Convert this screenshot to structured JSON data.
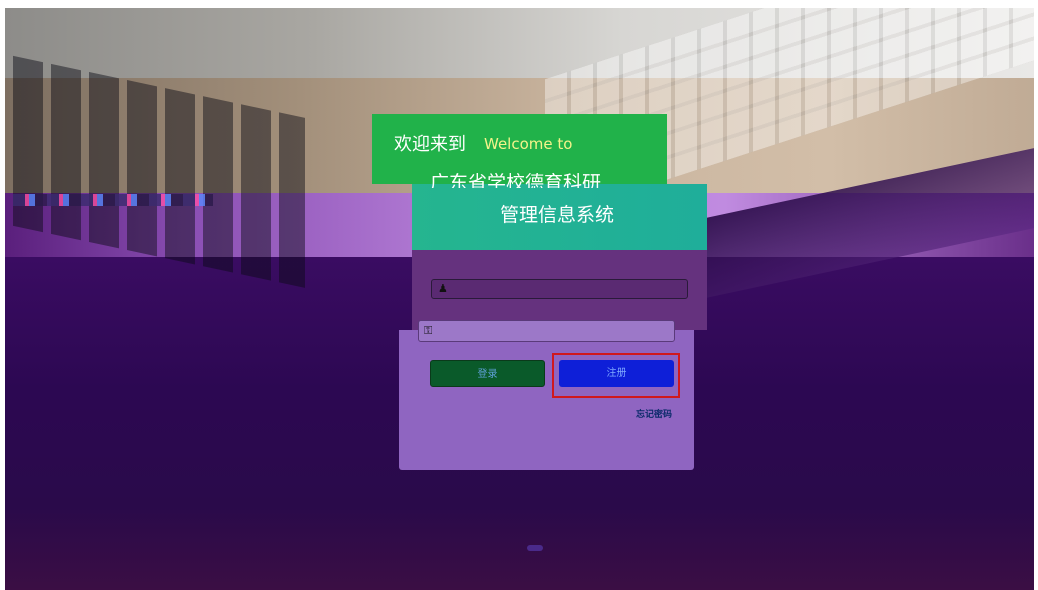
{
  "welcome": {
    "cn": "欢迎来到",
    "en": "Welcome to"
  },
  "system": {
    "title_line1": "广东省学校德育科研",
    "title_line2": "管理信息系统"
  },
  "form": {
    "username_placeholder": "",
    "password_placeholder": "",
    "login_label": "登录",
    "register_label": "注册",
    "forgot_label": "忘记密码"
  },
  "icons": {
    "username": "user-icon",
    "password": "key-icon"
  },
  "colors": {
    "header_green": "#21b24a",
    "header_teal": "#25b58f",
    "welcome_en": "#f3f38a",
    "login_button": "#0a5a2a",
    "register_button": "#0e1fd8",
    "register_highlight": "#d0181e"
  }
}
